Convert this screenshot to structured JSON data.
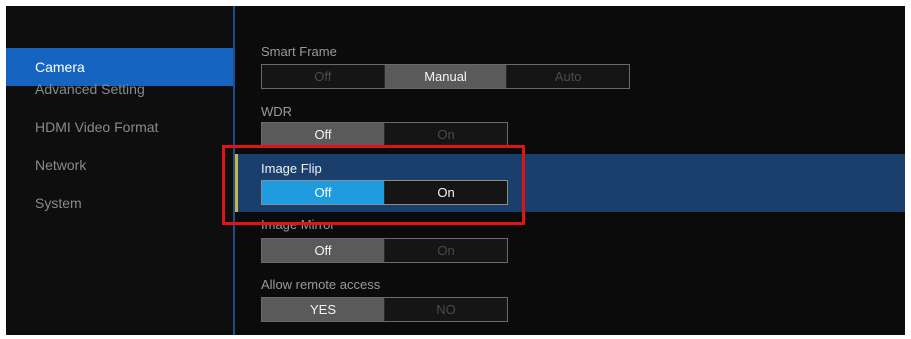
{
  "sidebar": {
    "items": [
      {
        "label": "Camera",
        "active": true
      },
      {
        "label": "Advanced Setting"
      },
      {
        "label": "HDMI Video Format"
      },
      {
        "label": "Network"
      },
      {
        "label": "System"
      }
    ]
  },
  "settings": {
    "smart_frame": {
      "label": "Smart Frame",
      "options": [
        "Off",
        "Manual",
        "Auto"
      ],
      "selected": "Manual"
    },
    "wdr": {
      "label": "WDR",
      "options": [
        "Off",
        "On"
      ],
      "selected": "Off"
    },
    "image_flip": {
      "label": "Image Flip",
      "options": [
        "Off",
        "On"
      ],
      "selected": "Off"
    },
    "image_mirror": {
      "label": "Image Mirror",
      "options": [
        "Off",
        "On"
      ],
      "selected": "Off"
    },
    "allow_remote_access": {
      "label": "Allow remote access",
      "options": [
        "YES",
        "NO"
      ],
      "selected": "YES"
    }
  },
  "colors": {
    "accent": "#1565c0",
    "selected_highlight": "#1f9be0",
    "annotation": "#e01414"
  }
}
